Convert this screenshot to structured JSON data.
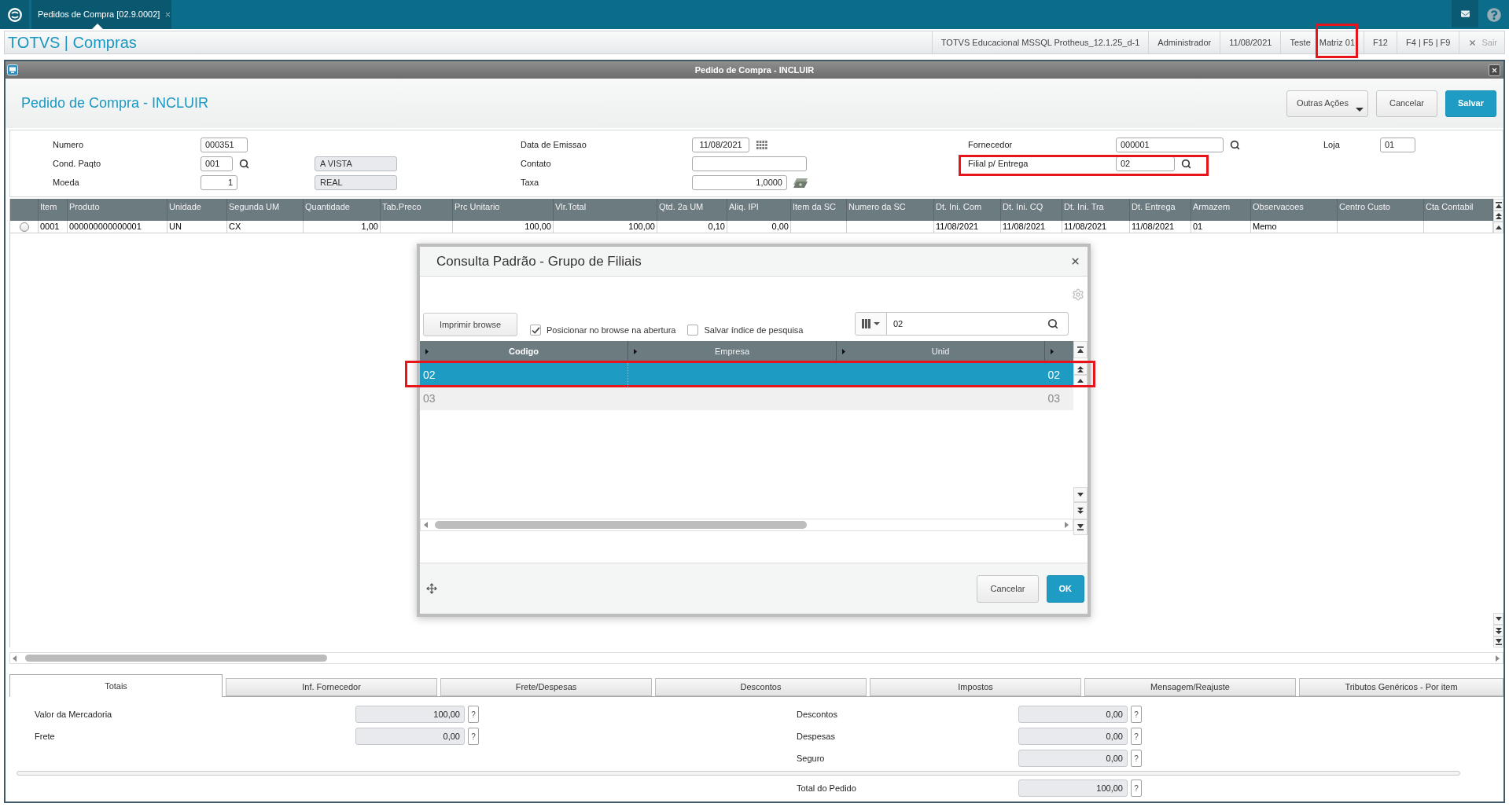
{
  "top_bar": {
    "tab": {
      "label": "Pedidos de Compra [02.9.0002]",
      "selected": true
    }
  },
  "header": {
    "title": "TOTVS | Compras",
    "environment": "TOTVS Educacional MSSQL Protheus_12.1.25_d-1",
    "user": "Administrador",
    "date": "11/08/2021",
    "company": "Teste",
    "branch": {
      "label": "Matriz 01",
      "highlighted": true
    },
    "shortcuts": [
      "F12",
      "F4 | F5 | F9"
    ],
    "exit": {
      "label": "Sair",
      "disabled": true
    }
  },
  "window": {
    "title": "Pedido de Compra - INCLUIR",
    "heading": "Pedido de Compra - INCLUIR",
    "actions": [
      {
        "label": "Outras Ações",
        "kind": "menu"
      },
      {
        "label": "Cancelar",
        "kind": "default"
      },
      {
        "label": "Salvar",
        "kind": "primary"
      }
    ]
  },
  "form": {
    "columns": [
      [
        {
          "label": "Numero",
          "kind": "text",
          "value": "000351"
        },
        {
          "label": "Cond. Paqto",
          "kind": "lookup",
          "value": "001",
          "description": "A VISTA"
        },
        {
          "label": "Moeda",
          "kind": "number",
          "value": "1",
          "description": "REAL"
        }
      ],
      [
        {
          "label": "Data de Emissao",
          "kind": "date",
          "value": "11/08/2021"
        },
        {
          "label": "Contato",
          "kind": "text"
        },
        {
          "label": "Taxa",
          "kind": "rate",
          "value": "1,0000"
        }
      ],
      [
        {
          "label": "Fornecedor",
          "kind": "lookup",
          "value": "000001"
        },
        {
          "label": "Filial p/ Entrega",
          "kind": "lookup",
          "value": "02",
          "highlighted": true
        }
      ],
      [
        {
          "label": "Loja",
          "kind": "text",
          "value": "01"
        }
      ]
    ]
  },
  "grid": {
    "columns": [
      {
        "label": "Item",
        "kind": "text"
      },
      {
        "label": "Produto",
        "kind": "text"
      },
      {
        "label": "Unidade",
        "kind": "text"
      },
      {
        "label": "Segunda UM",
        "kind": "text"
      },
      {
        "label": "Quantidade",
        "kind": "number"
      },
      {
        "label": "Tab.Preco",
        "kind": "text"
      },
      {
        "label": "Prc Unitario",
        "kind": "number"
      },
      {
        "label": "Vlr.Total",
        "kind": "number"
      },
      {
        "label": "Qtd. 2a UM",
        "kind": "number"
      },
      {
        "label": "Aliq. IPI",
        "kind": "number"
      },
      {
        "label": "Item da SC",
        "kind": "text"
      },
      {
        "label": "Numero da SC",
        "kind": "text"
      },
      {
        "label": "Dt. Ini. Com",
        "kind": "text"
      },
      {
        "label": "Dt. Ini. CQ",
        "kind": "text"
      },
      {
        "label": "Dt. Ini. Tra",
        "kind": "text"
      },
      {
        "label": "Dt. Entrega",
        "kind": "text"
      },
      {
        "label": "Armazem",
        "kind": "text"
      },
      {
        "label": "Observacoes",
        "kind": "text"
      },
      {
        "label": "Centro Custo",
        "kind": "text"
      },
      {
        "label": "Cta Contabil",
        "kind": "text"
      }
    ],
    "rows": [
      {
        "selected": false,
        "cells": [
          "0001",
          "000000000000001",
          "UN",
          "CX",
          "1,00",
          null,
          "100,00",
          "100,00",
          "0,10",
          "0,00",
          null,
          null,
          "11/08/2021",
          "11/08/2021",
          "11/08/2021",
          "11/08/2021",
          "01",
          "Memo",
          null,
          null
        ]
      }
    ]
  },
  "dialog": {
    "title": "Consulta Padrão - Grupo de Filiais",
    "print_button": "Imprimir browse",
    "options": [
      {
        "label": "Posicionar no browse na abertura",
        "checked": true
      },
      {
        "label": "Salvar índice de pesquisa",
        "checked": false
      }
    ],
    "search": {
      "value": "02"
    },
    "columns": [
      {
        "label": "Codigo",
        "sorted": true
      },
      {
        "label": "Empresa",
        "sorted": false
      },
      {
        "label": "Unid",
        "sorted": false
      }
    ],
    "rows": [
      {
        "codigo": "02",
        "column_4": "02",
        "selected": true,
        "highlighted": true
      },
      {
        "codigo": "03",
        "column_4": "03",
        "selected": false,
        "highlighted": false
      }
    ],
    "buttons": [
      {
        "label": "Cancelar",
        "kind": "default"
      },
      {
        "label": "OK",
        "kind": "primary"
      }
    ]
  },
  "tabs": [
    {
      "label": "Totais",
      "selected": true
    },
    {
      "label": "Inf. Fornecedor",
      "selected": false
    },
    {
      "label": "Frete/Despesas",
      "selected": false
    },
    {
      "label": "Descontos",
      "selected": false
    },
    {
      "label": "Impostos",
      "selected": false
    },
    {
      "label": "Mensagem/Reajuste",
      "selected": false
    },
    {
      "label": "Tributos Genéricos - Por item",
      "selected": false
    }
  ],
  "totals": {
    "left": [
      {
        "label": "Valor da Mercadoria",
        "value": "100,00",
        "help": "?"
      },
      {
        "label": "Frete",
        "value": "0,00",
        "help": "?"
      }
    ],
    "right": [
      {
        "label": "Descontos",
        "value": "0,00",
        "help": "?"
      },
      {
        "label": "Despesas",
        "value": "0,00",
        "help": "?"
      },
      {
        "label": "Seguro",
        "value": "0,00",
        "help": "?"
      }
    ],
    "total": {
      "label": "Total do Pedido",
      "value": "100,00",
      "help": "?"
    }
  }
}
